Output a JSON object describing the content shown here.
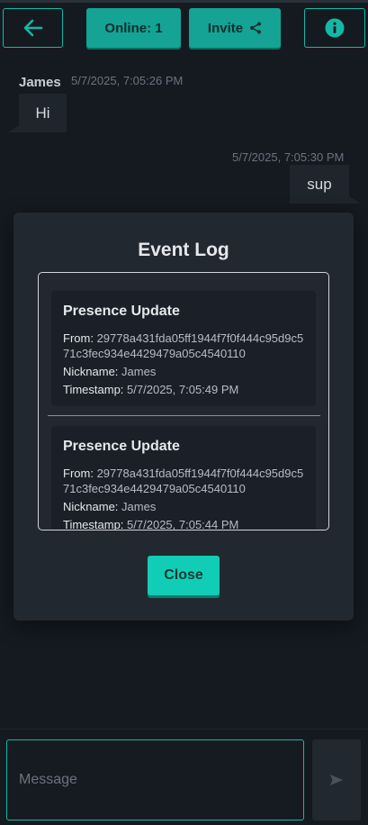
{
  "header": {
    "back_icon": "arrow-left-icon",
    "online_label": "Online: 1",
    "invite_label": "Invite",
    "invite_icon": "share-icon",
    "info_icon": "info-icon"
  },
  "messages": [
    {
      "sender": "James",
      "timestamp": "5/7/2025, 7:05:26 PM",
      "text": "Hi",
      "side": "left"
    },
    {
      "sender": "",
      "timestamp": "5/7/2025, 7:05:30 PM",
      "text": "sup",
      "side": "right"
    }
  ],
  "event_log": {
    "title": "Event Log",
    "entries": [
      {
        "title": "Presence Update",
        "from_label": "From:",
        "from_value": "29778a431fda05ff1944f7f0f444c95d9c571c3fec934e4429479a05c4540110",
        "nickname_label": "Nickname:",
        "nickname_value": "James",
        "timestamp_label": "Timestamp:",
        "timestamp_value": "5/7/2025, 7:05:49 PM"
      },
      {
        "title": "Presence Update",
        "from_label": "From:",
        "from_value": "29778a431fda05ff1944f7f0f444c95d9c571c3fec934e4429479a05c4540110",
        "nickname_label": "Nickname:",
        "nickname_value": "James",
        "timestamp_label": "Timestamp:",
        "timestamp_value": "5/7/2025, 7:05:44 PM"
      }
    ],
    "close_label": "Close"
  },
  "composer": {
    "placeholder": "Message",
    "value": "",
    "send_icon": "send-icon"
  },
  "colors": {
    "accent": "#14b8a6",
    "background": "#151a20",
    "panel": "#222830"
  }
}
